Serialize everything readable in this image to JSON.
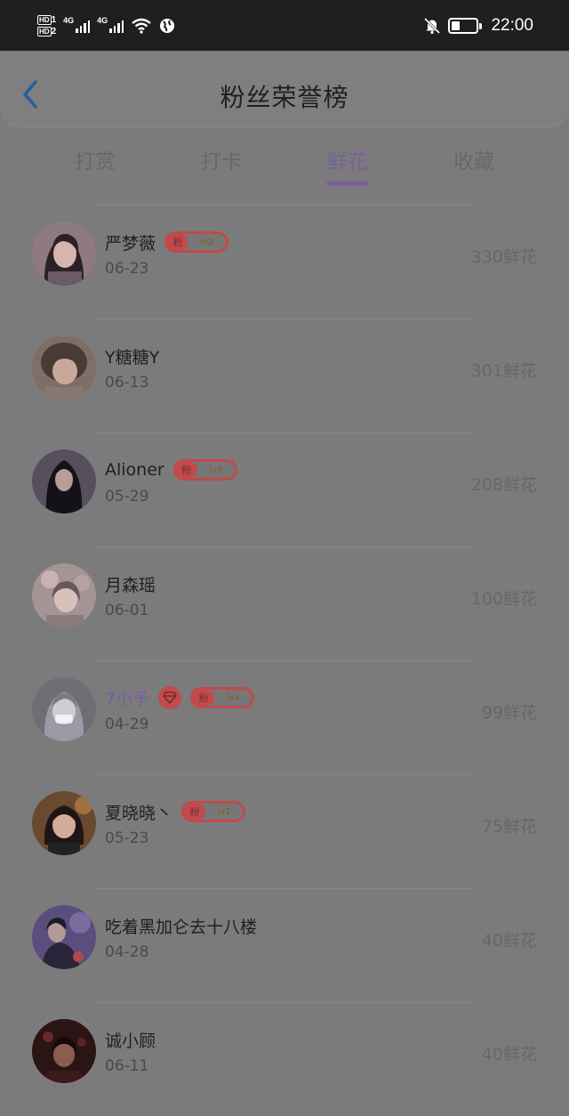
{
  "status_bar": {
    "sim1": "HD",
    "sim1_no": "1",
    "sim2": "HD",
    "sim2_no": "2",
    "net1": "4G",
    "net2": "4G",
    "time": "22:00",
    "icons": [
      "signal-icon",
      "wifi-icon",
      "globe-icon",
      "bell-muted-icon",
      "battery-icon"
    ]
  },
  "header": {
    "title": "粉丝荣誉榜",
    "back_icon": "chevron-left-icon"
  },
  "tabs": [
    {
      "label": "打赏",
      "active": false
    },
    {
      "label": "打卡",
      "active": false
    },
    {
      "label": "鲜花",
      "active": true
    },
    {
      "label": "收藏",
      "active": false
    }
  ],
  "colors": {
    "accent": "#7a5e9e",
    "badge": "#c24a4a"
  },
  "fans": [
    {
      "name": "严梦薇",
      "date": "06-23",
      "amount": "330鲜花",
      "badge_char": "粉",
      "level": "lv2",
      "vip": false
    },
    {
      "name": "Y糖糖Y",
      "date": "06-13",
      "amount": "301鲜花",
      "badge_char": "",
      "level": "",
      "vip": false
    },
    {
      "name": "Alioner",
      "date": "05-29",
      "amount": "208鲜花",
      "badge_char": "粉",
      "level": "lv3",
      "vip": false
    },
    {
      "name": "月森瑶",
      "date": "06-01",
      "amount": "100鲜花",
      "badge_char": "",
      "level": "",
      "vip": false
    },
    {
      "name": "7小予",
      "date": "04-29",
      "amount": "99鲜花",
      "badge_char": "粉",
      "level": "lv4",
      "vip": true
    },
    {
      "name": "夏晓晓丶",
      "date": "05-23",
      "amount": "75鲜花",
      "badge_char": "粉",
      "level": "lv1",
      "vip": false
    },
    {
      "name": "吃着黑加仑去十八楼",
      "date": "04-28",
      "amount": "40鲜花",
      "badge_char": "",
      "level": "",
      "vip": false
    },
    {
      "name": "诚小顾",
      "date": "06-11",
      "amount": "40鲜花",
      "badge_char": "",
      "level": "",
      "vip": false
    }
  ]
}
